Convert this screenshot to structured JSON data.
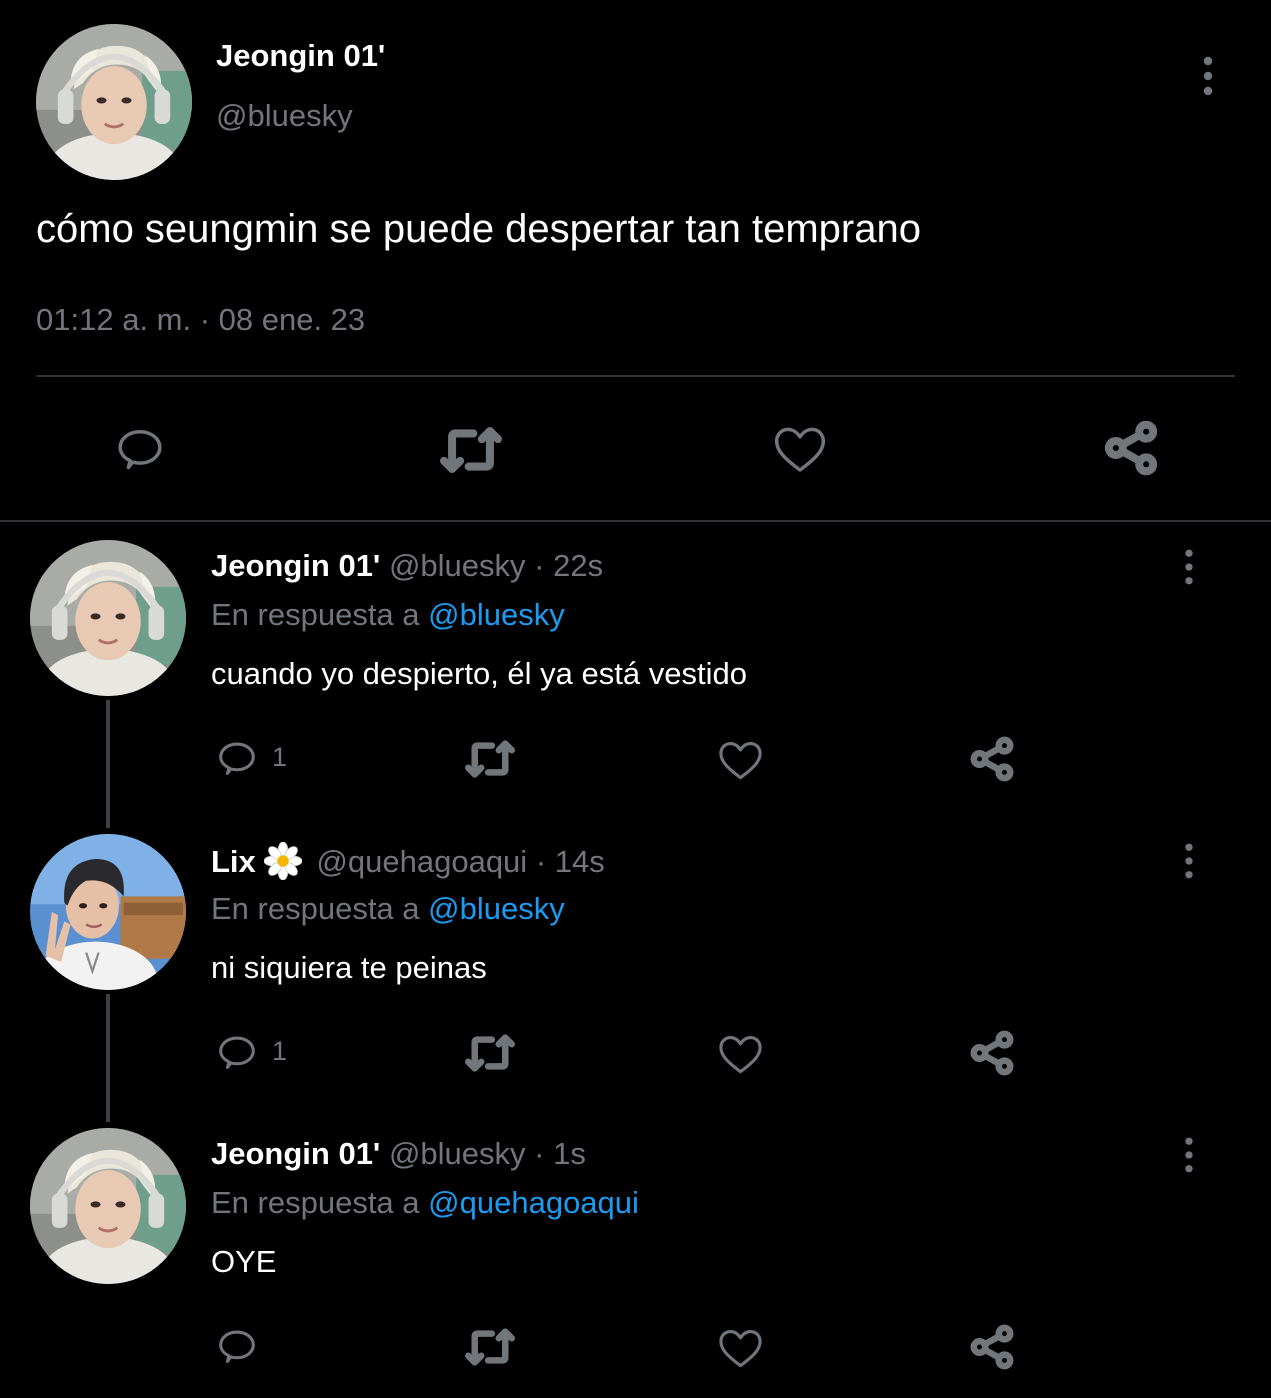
{
  "main_tweet": {
    "display_name": "Jeongin 01'",
    "handle": "@bluesky",
    "text": "cómo seungmin se puede despertar tan temprano",
    "timestamp": "01:12 a. m. · 08 ene. 23",
    "actions": [
      "reply-icon",
      "retweet-icon",
      "like-icon",
      "share-icon"
    ]
  },
  "replies": [
    {
      "display_name": "Jeongin 01'",
      "handle": "@bluesky",
      "time": "· 22s",
      "reply_prefix": "En respuesta a",
      "reply_to": "@bluesky",
      "text": "cuando yo despierto, él ya está vestido",
      "reply_count": "1"
    },
    {
      "display_name": "Lix",
      "name_emoji": "flower-icon",
      "handle": "@quehagoaqui",
      "time": "· 14s",
      "reply_prefix": "En respuesta a",
      "reply_to": "@bluesky",
      "text": "ni siquiera te peinas",
      "reply_count": "1"
    },
    {
      "display_name": "Jeongin 01'",
      "handle": "@bluesky",
      "time": "· 1s",
      "reply_prefix": "En respuesta a",
      "reply_to": "@quehagoaqui",
      "text": "OYE",
      "reply_count": ""
    }
  ],
  "colors": {
    "background": "#000000",
    "primary_text": "#ffffff",
    "secondary_text": "#71767b",
    "link": "#1d9bf0",
    "divider": "#2f3336"
  }
}
